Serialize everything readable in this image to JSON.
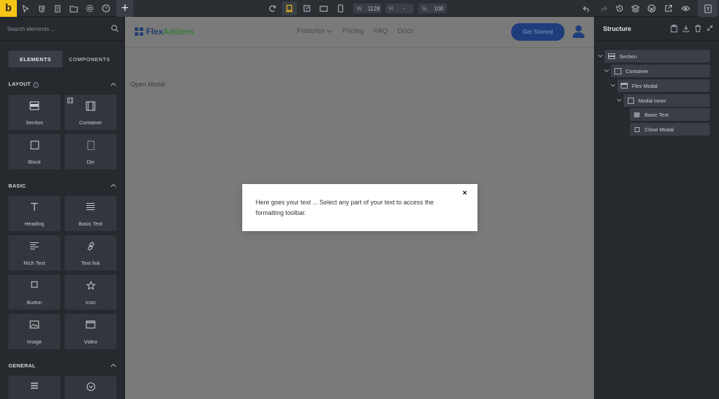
{
  "toolbar": {
    "logo": "b",
    "width_label": "W",
    "width_value": "1128",
    "height_label": "H",
    "height_value": "-",
    "zoom_label": "%",
    "zoom_value": "100",
    "add_label": "+"
  },
  "left_panel": {
    "search_placeholder": "Search elements ...",
    "tabs": [
      {
        "label": "ELEMENTS",
        "active": true
      },
      {
        "label": "COMPONENTS",
        "active": false
      }
    ],
    "sections": [
      {
        "title": "LAYOUT",
        "items": [
          "Section",
          "Container",
          "Block",
          "Div"
        ]
      },
      {
        "title": "BASIC",
        "items": [
          "Heading",
          "Basic Text",
          "Rich Text",
          "Text link",
          "Button",
          "Icon",
          "Image",
          "Video"
        ]
      },
      {
        "title": "GENERAL",
        "items": [
          "",
          ""
        ]
      }
    ]
  },
  "canvas": {
    "brand_part1": "Flex",
    "brand_part2": "Addons",
    "nav": [
      "Features",
      "Pricing",
      "FAQ",
      "Docs"
    ],
    "cta_label": "Get Started",
    "open_modal_label": "Open Modal",
    "modal_text": "Here goes your text ... Select any part of your text to access the formatting toolbar.",
    "modal_close": "×"
  },
  "structure": {
    "title": "Structure",
    "tree": [
      {
        "label": "Section",
        "level": 0
      },
      {
        "label": "Container",
        "level": 1
      },
      {
        "label": "Flex Modal",
        "level": 2
      },
      {
        "label": "Modal Inner",
        "level": 3
      },
      {
        "label": "Basic Text",
        "level": 4
      },
      {
        "label": "Close Modal",
        "level": 4
      }
    ]
  },
  "colors": {
    "accent": "#f5c518",
    "panel_bg": "#26292e",
    "canvas_overlay": "#7a7a7a",
    "cta_bg": "#1f3d7a"
  }
}
